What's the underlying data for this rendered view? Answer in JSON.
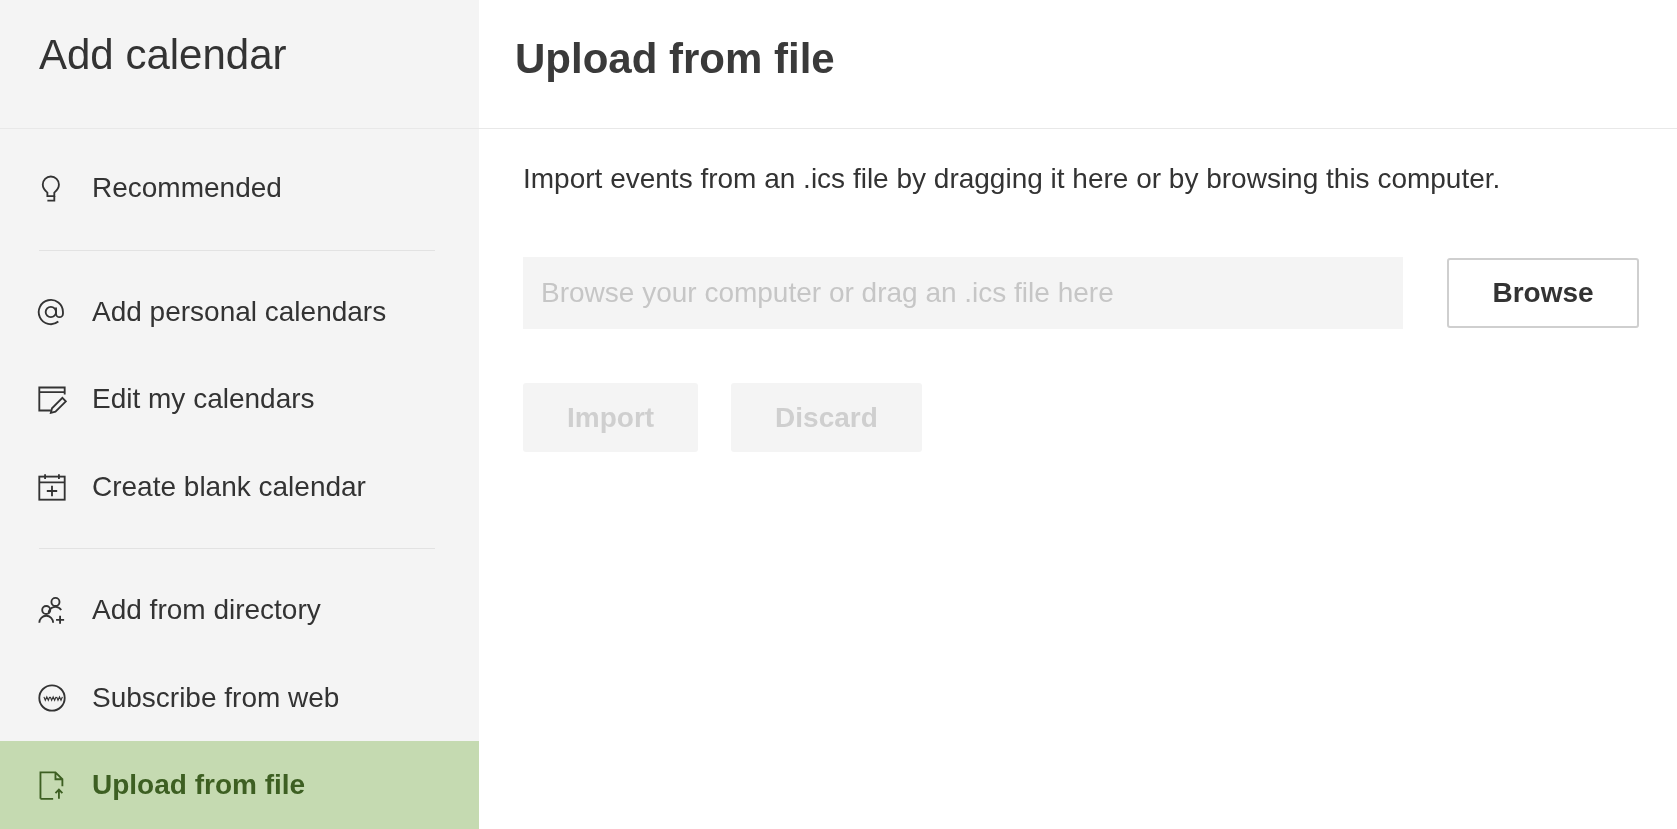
{
  "sidebar": {
    "title": "Add calendar",
    "groups": [
      [
        {
          "label": "Recommended",
          "selected": false
        }
      ],
      [
        {
          "label": "Add personal calendars",
          "selected": false
        },
        {
          "label": "Edit my calendars",
          "selected": false
        },
        {
          "label": "Create blank calendar",
          "selected": false
        }
      ],
      [
        {
          "label": "Add from directory",
          "selected": false
        },
        {
          "label": "Subscribe from web",
          "selected": false
        },
        {
          "label": "Upload from file",
          "selected": true
        }
      ]
    ]
  },
  "main": {
    "title": "Upload from file",
    "description": "Import events from an .ics file by dragging it here or by browsing this computer.",
    "file_field": {
      "placeholder": "Browse your computer or drag an .ics file here"
    },
    "browse_button": {
      "label": "Browse",
      "disabled": false
    },
    "buttons": [
      {
        "label": "Import",
        "disabled": true
      },
      {
        "label": "Discard",
        "disabled": true
      }
    ]
  }
}
